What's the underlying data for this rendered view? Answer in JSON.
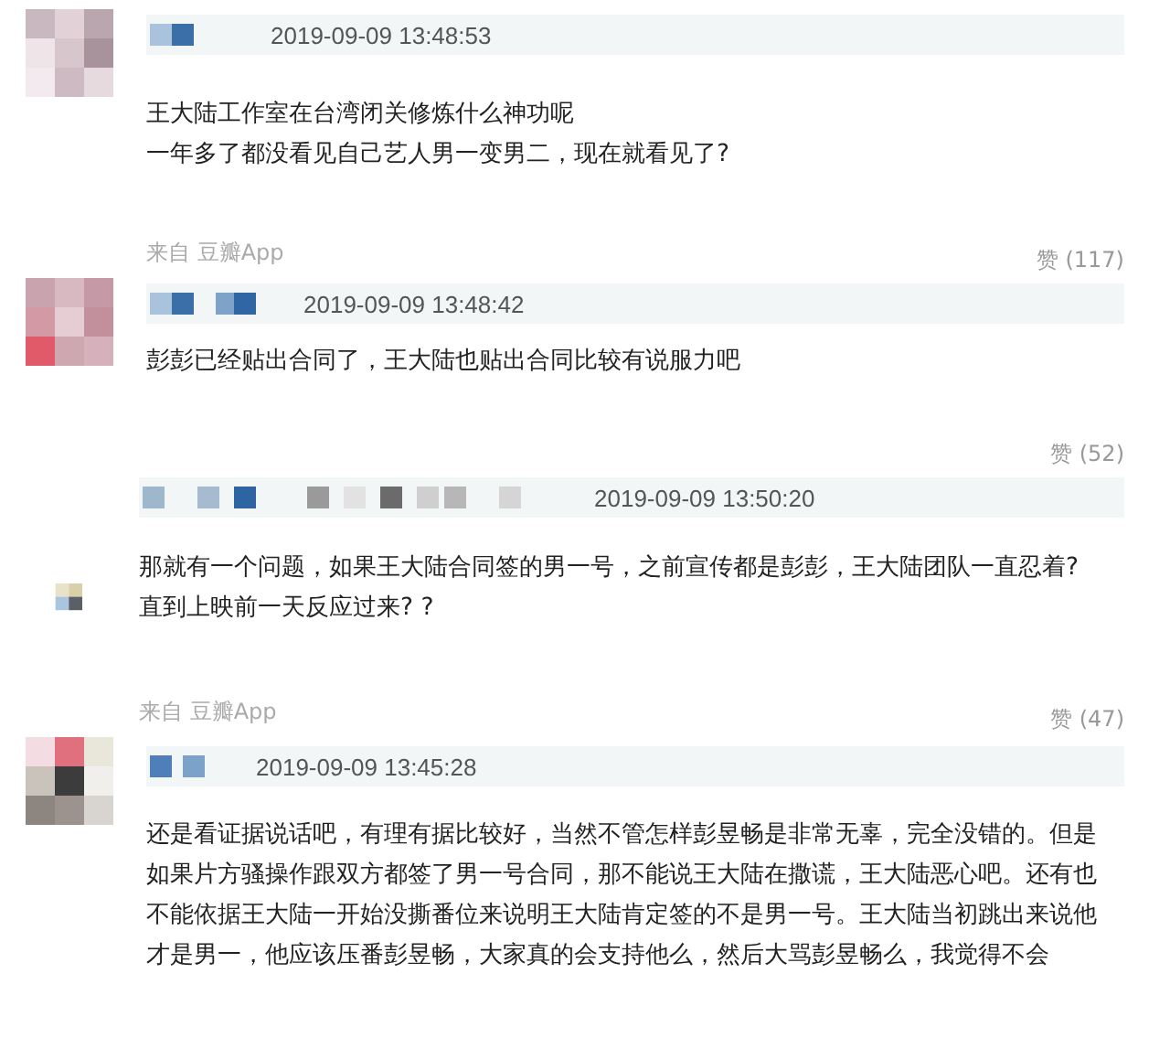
{
  "comments": [
    {
      "time": "2019-09-09 13:48:53",
      "lines": [
        "王大陆工作室在台湾闭关修炼什么神功呢",
        "一年多了都没看见自己艺人男一变男二，现在就看见了?"
      ],
      "source": "来自 豆瓣App",
      "likes": "赞 (117)"
    },
    {
      "time": "2019-09-09 13:48:42",
      "lines": [
        "彭彭已经贴出合同了，王大陆也贴出合同比较有说服力吧"
      ],
      "likes": "赞 (52)"
    },
    {
      "time": "2019-09-09 13:50:20",
      "lines": [
        "那就有一个问题，如果王大陆合同签的男一号，之前宣传都是彭彭，王大陆团队一直忍着?",
        "直到上映前一天反应过来? ?"
      ],
      "source": "来自 豆瓣App",
      "likes": "赞 (47)"
    },
    {
      "time": "2019-09-09 13:45:28",
      "lines": [
        "还是看证据说话吧，有理有据比较好，当然不管怎样彭昱畅是非常无辜，完全没错的。但是",
        "如果片方骚操作跟双方都签了男一号合同，那不能说王大陆在撒谎，王大陆恶心吧。还有也",
        "不能依据王大陆一开始没撕番位来说明王大陆肯定签的不是男一号。王大陆当初跳出来说他",
        "才是男一，他应该压番彭昱畅，大家真的会支持他么，然后大骂彭昱畅么，我觉得不会"
      ]
    }
  ]
}
